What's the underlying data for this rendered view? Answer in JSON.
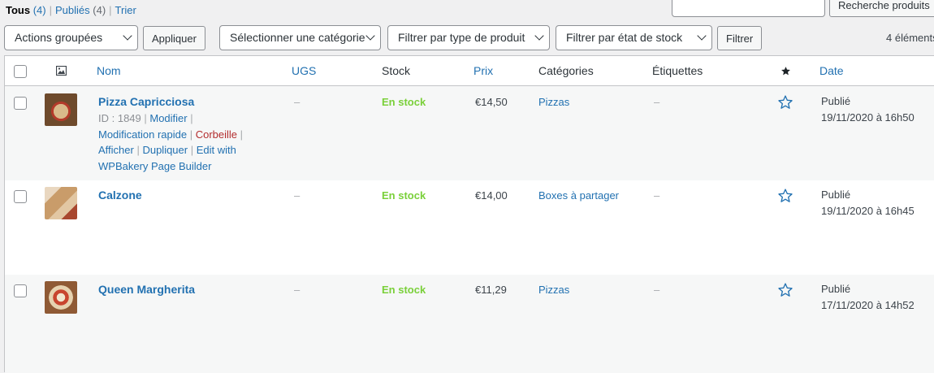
{
  "filters": {
    "all_label": "Tous",
    "all_count": "(4)",
    "published_label": "Publiés",
    "published_count": "(4)",
    "sort_label": "Trier"
  },
  "search": {
    "button_label": "Recherche produits",
    "value": ""
  },
  "toolbar": {
    "bulk_actions": "Actions groupées",
    "apply_label": "Appliquer",
    "category_select": "Sélectionner une catégorie",
    "type_select": "Filtrer par type de produit",
    "stock_select": "Filtrer par état de stock",
    "filter_label": "Filtrer",
    "items_count": "4 éléments"
  },
  "columns": {
    "name": "Nom",
    "sku": "UGS",
    "stock": "Stock",
    "price": "Prix",
    "categories": "Catégories",
    "tags": "Étiquettes",
    "date": "Date"
  },
  "products": [
    {
      "name": "Pizza Capricciosa",
      "id_text": "ID : 1849",
      "action_edit": "Modifier",
      "action_quick_edit": "Modification rapide",
      "action_trash": "Corbeille",
      "action_view": "Afficher",
      "action_duplicate": "Dupliquer",
      "action_wpbakery": "Edit with WPBakery Page Builder",
      "sku": "–",
      "stock": "En stock",
      "price": "€14,50",
      "category": "Pizzas",
      "tags": "–",
      "status": "Publié",
      "date": "19/11/2020 à 16h50"
    },
    {
      "name": "Calzone",
      "sku": "–",
      "stock": "En stock",
      "price": "€14,00",
      "category": "Boxes à partager",
      "tags": "–",
      "status": "Publié",
      "date": "19/11/2020 à 16h45"
    },
    {
      "name": "Queen Margherita",
      "sku": "–",
      "stock": "En stock",
      "price": "€11,29",
      "category": "Pizzas",
      "tags": "–",
      "status": "Publié",
      "date": "17/11/2020 à 14h52"
    }
  ],
  "colors": {
    "link": "#2271b1",
    "in_stock": "#7ad03a",
    "trash": "#b32d2e"
  }
}
